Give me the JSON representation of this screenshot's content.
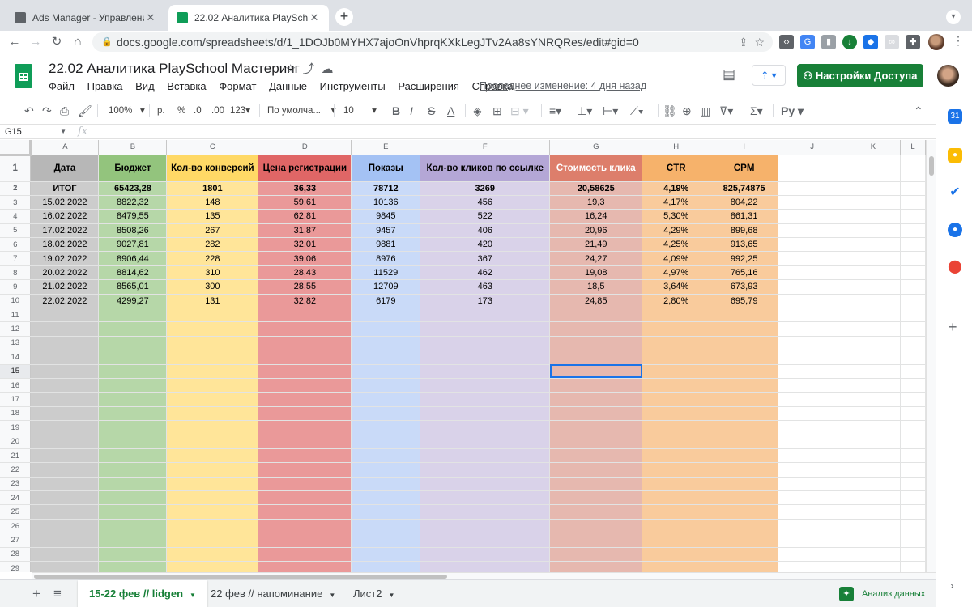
{
  "browser": {
    "tabs": [
      {
        "title": "Ads Manager - Управление ре",
        "active": false
      },
      {
        "title": "22.02 Аналитика PlaySchool М",
        "active": true
      }
    ],
    "url": "docs.google.com/spreadsheets/d/1_1DOJb0MYHX7ajoOnVhprqKXkLegJTv2Aa8sYNRQRes/edit#gid=0"
  },
  "doc": {
    "title": "22.02 Аналитика PlaySchool Мастеринг",
    "menu": [
      "Файл",
      "Правка",
      "Вид",
      "Вставка",
      "Формат",
      "Данные",
      "Инструменты",
      "Расширения",
      "Справка"
    ],
    "last_edit": "Последнее изменение: 4 дня назад",
    "share_label": "Настройки Доступа"
  },
  "toolbar": {
    "zoom": "100%",
    "currency": "р.",
    "percent": "%",
    "dec_dec": ".0",
    "dec_inc": ".00",
    "format_more": "123",
    "font": "По умолча...",
    "font_size": "10"
  },
  "formula_bar": {
    "cell_ref": "G15",
    "fx": "fx"
  },
  "grid": {
    "columns": [
      "A",
      "B",
      "C",
      "D",
      "E",
      "F",
      "G",
      "H",
      "I",
      "J",
      "K",
      "L"
    ],
    "col_colors": [
      "#cccccc",
      "#b6d7a8",
      "#ffe599",
      "#ea9999",
      "#c9daf8",
      "#d9d2e9",
      "#e6b8af",
      "#f9cb9c",
      "#f9cb9c",
      "#ffffff",
      "#ffffff",
      "#ffffff"
    ],
    "header_colors": [
      "#b7b7b7",
      "#93c47d",
      "#ffd966",
      "#e06666",
      "#a4c2f4",
      "#b4a7d6",
      "#dd7e6b",
      "#f6b26b",
      "#f6b26b",
      "#ffffff",
      "#ffffff",
      "#ffffff"
    ],
    "header_text_colors": [
      "#000000",
      "#000000",
      "#000000",
      "#000000",
      "#000000",
      "#000000",
      "#ffffff",
      "#000000",
      "#000000",
      "#000000",
      "#000000",
      "#000000"
    ],
    "headers": [
      "Дата",
      "Бюджет",
      "Кол-во конверсий",
      "Цена регистрации",
      "Показы",
      "Кол-во кликов по ссылке",
      "Стоимость клика",
      "CTR",
      "CPM"
    ],
    "total": [
      "ИТОГ",
      "65423,28",
      "1801",
      "36,33",
      "78712",
      "3269",
      "20,58625",
      "4,19%",
      "825,74875"
    ],
    "rows": [
      [
        "15.02.2022",
        "8822,32",
        "148",
        "59,61",
        "10136",
        "456",
        "19,3",
        "4,17%",
        "804,22"
      ],
      [
        "16.02.2022",
        "8479,55",
        "135",
        "62,81",
        "9845",
        "522",
        "16,24",
        "5,30%",
        "861,31"
      ],
      [
        "17.02.2022",
        "8508,26",
        "267",
        "31,87",
        "9457",
        "406",
        "20,96",
        "4,29%",
        "899,68"
      ],
      [
        "18.02.2022",
        "9027,81",
        "282",
        "32,01",
        "9881",
        "420",
        "21,49",
        "4,25%",
        "913,65"
      ],
      [
        "19.02.2022",
        "8906,44",
        "228",
        "39,06",
        "8976",
        "367",
        "24,27",
        "4,09%",
        "992,25"
      ],
      [
        "20.02.2022",
        "8814,62",
        "310",
        "28,43",
        "11529",
        "462",
        "19,08",
        "4,97%",
        "765,16"
      ],
      [
        "21.02.2022",
        "8565,01",
        "300",
        "28,55",
        "12709",
        "463",
        "18,5",
        "3,64%",
        "673,93"
      ],
      [
        "22.02.2022",
        "4299,27",
        "131",
        "32,82",
        "6179",
        "173",
        "24,85",
        "2,80%",
        "695,79"
      ]
    ],
    "empty_row_numbers": [
      "11",
      "12",
      "13",
      "14",
      "15",
      "16",
      "17",
      "18",
      "19",
      "20",
      "21",
      "22",
      "23",
      "24",
      "25",
      "26",
      "27",
      "28",
      "29"
    ],
    "selected_row": "15"
  },
  "sheets": {
    "tabs": [
      "15-22 фев // lidgen",
      "22 фев // напоминание",
      "Лист2"
    ],
    "active_index": 0,
    "explore_label": "Анализ данных"
  }
}
